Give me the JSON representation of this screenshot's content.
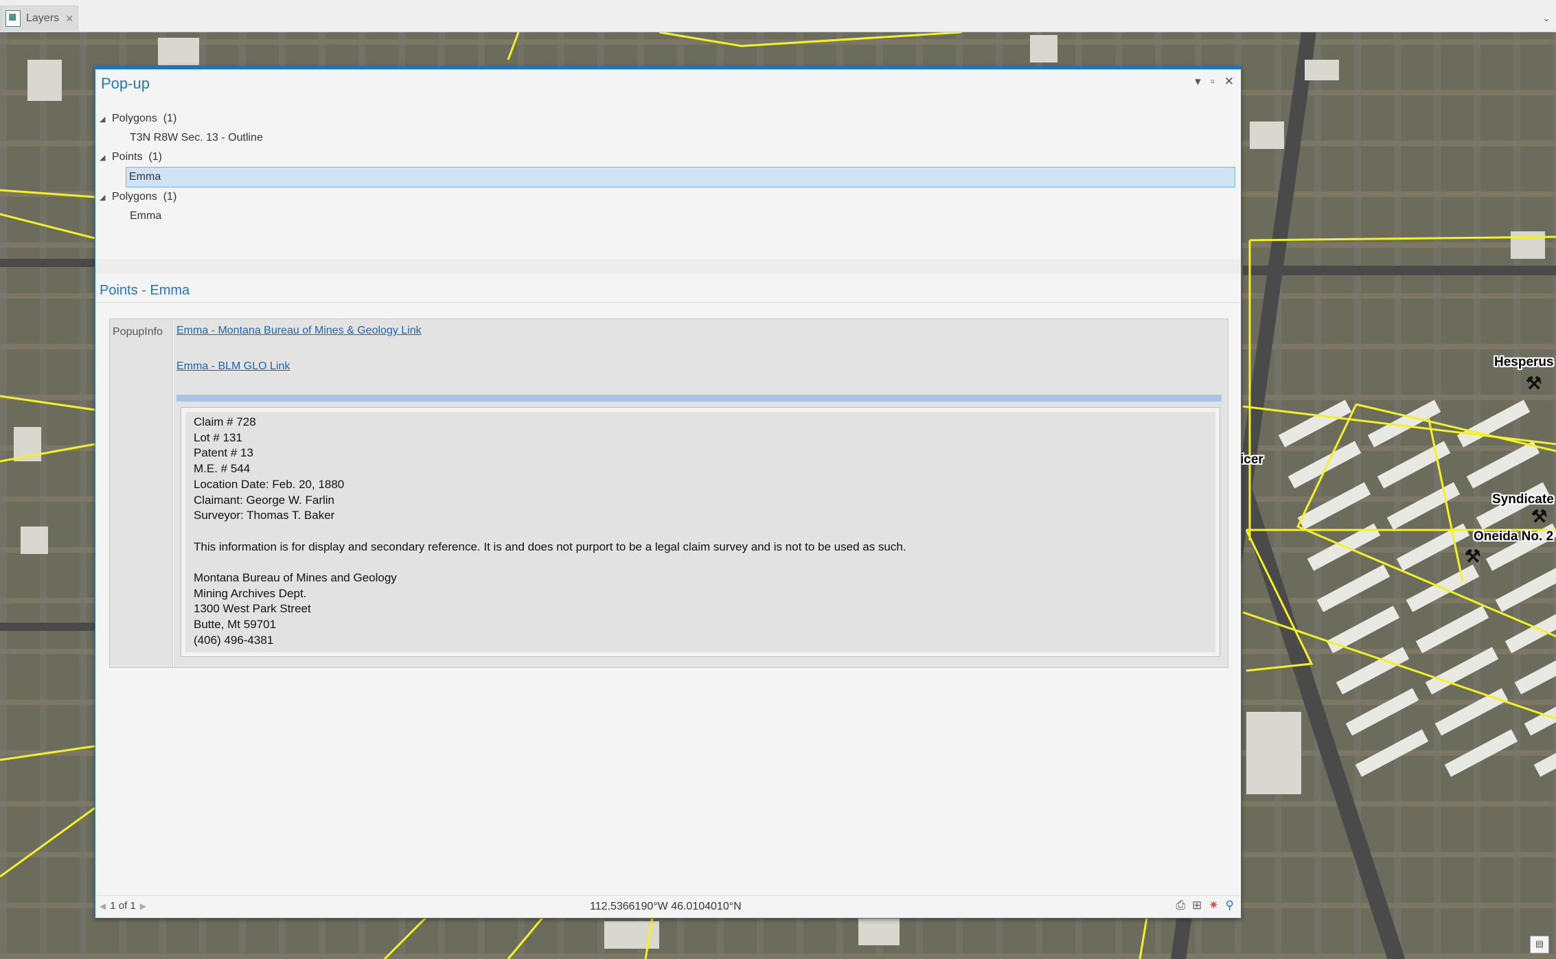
{
  "tabstrip": {
    "tab_label": "Layers",
    "tab_icon": "layers-icon",
    "close_glyph": "×",
    "overflow_glyph": "⌄"
  },
  "map": {
    "labels": {
      "hesperus": "Hesperus",
      "syndicate": "Syndicate",
      "oneida": "Oneida No. 2",
      "partial_left": "icer"
    },
    "colors": {
      "parcel_lines": "#f2f224"
    }
  },
  "popup": {
    "title": "Pop-up",
    "controls": {
      "menu_glyph": "▾",
      "maximize_glyph": "▫",
      "close_glyph": "✕"
    },
    "tree": [
      {
        "group": "Polygons",
        "count": "(1)",
        "child": "T3N R8W Sec. 13 - Outline",
        "selected": false
      },
      {
        "group": "Points",
        "count": "(1)",
        "child": "Emma",
        "selected": true
      },
      {
        "group": "Polygons",
        "count": "(1)",
        "child": "Emma",
        "selected": false
      }
    ],
    "section_title": "Points - Emma",
    "field_name": "PopupInfo",
    "links": {
      "mbmg": "Emma - Montana Bureau of Mines & Geology Link",
      "blm": "Emma - BLM GLO Link"
    },
    "details": [
      "Claim # 728",
      "Lot # 131",
      "Patent # 13",
      "M.E. # 544",
      "Location Date: Feb. 20, 1880",
      "Claimant: George W. Farlin",
      "Surveyor: Thomas T. Baker",
      "",
      "This information is for display and secondary reference. It is and does not purport to be a legal claim survey and is not to be used as such.",
      "",
      "Montana Bureau of Mines and Geology",
      "Mining Archives Dept.",
      "1300 West Park Street",
      "Butte, Mt 59701",
      "(406) 496-4381"
    ],
    "footer": {
      "pager_text": "1 of 1",
      "coordinates": "112.5366190°W 46.0104010°N",
      "tools": [
        "print-icon",
        "export-icon",
        "flash-icon",
        "zoom-to-icon"
      ]
    },
    "accent_color": "#2576c2",
    "selection_color": "#cfe3f5"
  }
}
